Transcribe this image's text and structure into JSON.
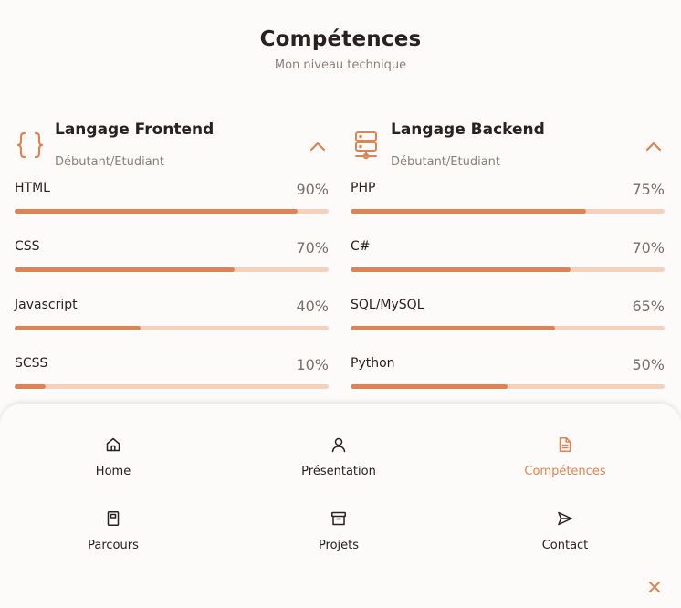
{
  "colors": {
    "accent": "#de8453",
    "accent_light": "#f6d0bb",
    "text": "#27211f",
    "muted": "#8b7f7b",
    "background": "#fdfbfa"
  },
  "section": {
    "title": "Compétences",
    "subtitle": "Mon niveau technique"
  },
  "frontend": {
    "icon": "braces-icon",
    "title": "Langage Frontend",
    "level": "Débutant/Etudiant",
    "toggle_icon": "chevron-up-icon",
    "skills": [
      {
        "name": "HTML",
        "percent_label": "90%",
        "percent": 90
      },
      {
        "name": "CSS",
        "percent_label": "70%",
        "percent": 70
      },
      {
        "name": "Javascript",
        "percent_label": "40%",
        "percent": 40
      },
      {
        "name": "SCSS",
        "percent_label": "10%",
        "percent": 10
      }
    ]
  },
  "backend": {
    "icon": "server-icon",
    "title": "Langage Backend",
    "level": "Débutant/Etudiant",
    "toggle_icon": "chevron-up-icon",
    "skills": [
      {
        "name": "PHP",
        "percent_label": "75%",
        "percent": 75
      },
      {
        "name": "C#",
        "percent_label": "70%",
        "percent": 70
      },
      {
        "name": "SQL/MySQL",
        "percent_label": "65%",
        "percent": 65
      },
      {
        "name": "Python",
        "percent_label": "50%",
        "percent": 50
      }
    ]
  },
  "nav": {
    "items": [
      {
        "label": "Home",
        "icon": "home-icon",
        "active": false
      },
      {
        "label": "Présentation",
        "icon": "user-icon",
        "active": false
      },
      {
        "label": "Compétences",
        "icon": "document-icon",
        "active": true
      },
      {
        "label": "Parcours",
        "icon": "book-icon",
        "active": false
      },
      {
        "label": "Projets",
        "icon": "archive-icon",
        "active": false
      },
      {
        "label": "Contact",
        "icon": "send-icon",
        "active": false
      }
    ],
    "close_icon": "close-icon"
  }
}
